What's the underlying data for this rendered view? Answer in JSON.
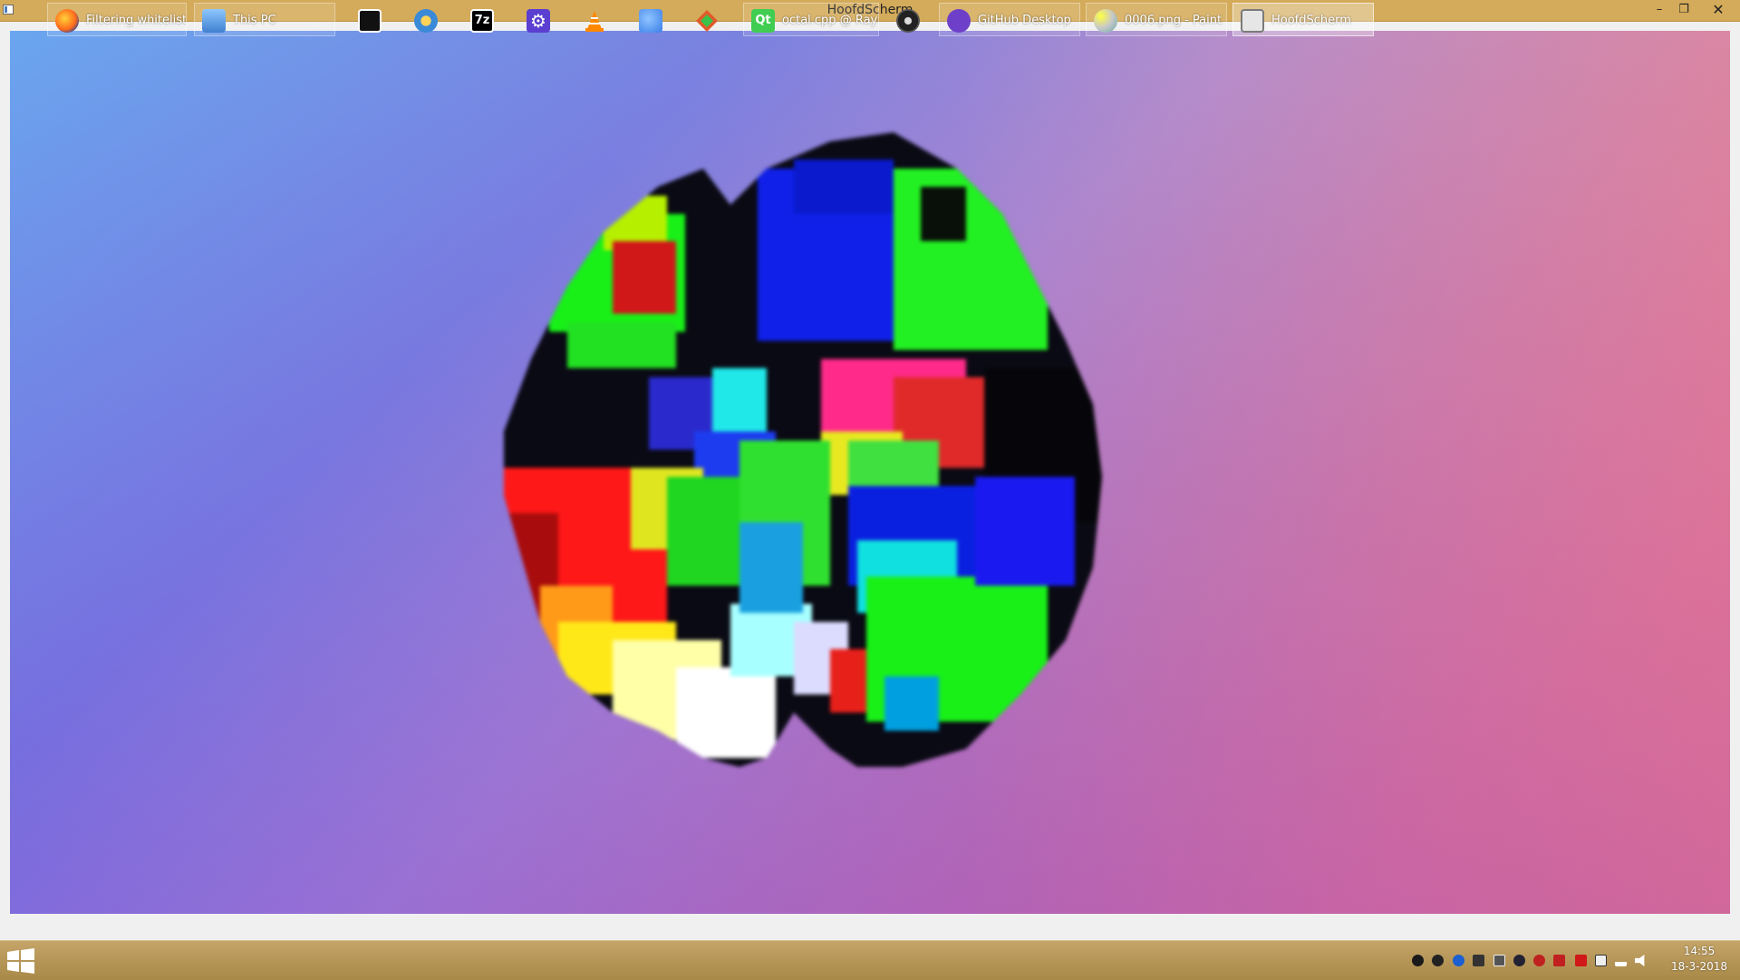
{
  "window": {
    "title": "HoofdScherm",
    "minimize_glyph": "–",
    "maximize_glyph": "❐",
    "close_glyph": "✕"
  },
  "viewport": {
    "content": "voxel-sphere-render",
    "gradient_colors": [
      "#6aa6ef",
      "#7a82e0",
      "#b08bcf",
      "#e96a8e"
    ]
  },
  "taskbar": {
    "tasks": [
      {
        "label": "Filtering whitelist ...",
        "icon": "firefox-icon",
        "color": "#ff7a1a"
      },
      {
        "label": "This PC",
        "icon": "computer-icon",
        "color": "#3f7fd0"
      },
      {
        "label": "",
        "icon": "inkscape-icon",
        "color": "#111111"
      },
      {
        "label": "",
        "icon": "fallout-vault-icon",
        "color": "#3a8ad8"
      },
      {
        "label": "",
        "icon": "7zip-icon",
        "color": "#000000"
      },
      {
        "label": "",
        "icon": "settings-gear-icon",
        "color": "#5b3fd0"
      },
      {
        "label": "",
        "icon": "vlc-cone-icon",
        "color": "#ff8800"
      },
      {
        "label": "",
        "icon": "bird-icon",
        "color": "#3a7ee8"
      },
      {
        "label": "",
        "icon": "git-diamond-icon",
        "color": "#e05a2a"
      },
      {
        "label": "octal.cpp @ Rayc...",
        "icon": "qt-creator-icon",
        "color": "#41cd52"
      },
      {
        "label": "",
        "icon": "obs-icon",
        "color": "#222222"
      },
      {
        "label": "GitHub Desktop",
        "icon": "github-icon",
        "color": "#6e40c9"
      },
      {
        "label": "0006.png - Paint",
        "icon": "paint-icon",
        "color": "#c8c8c8"
      },
      {
        "label": "HoofdScherm",
        "icon": "app-window-icon",
        "color": "#e6e6e6"
      }
    ],
    "tray_icons": [
      "obs-tray-icon",
      "s-tray-icon",
      "bluetooth-icon",
      "tools-icon",
      "display-icon",
      "steam-icon",
      "antivirus-icon",
      "volume-icon",
      "flag-icon",
      "battery-icon",
      "network-icon",
      "speaker-icon"
    ],
    "clock": {
      "time": "14:55",
      "date": "18-3-2018"
    }
  }
}
